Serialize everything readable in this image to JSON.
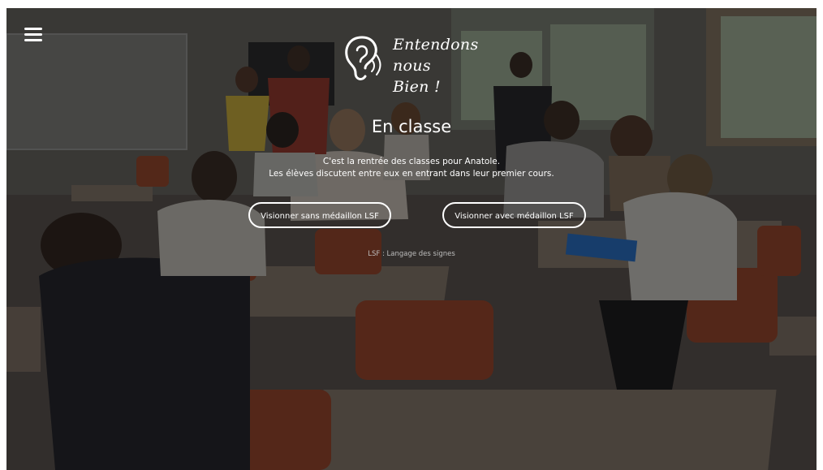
{
  "header": {
    "menu_icon": "hamburger-icon",
    "logo_icon": "ear-icon",
    "logo_line1": "Entendons nous",
    "logo_line2": "Bien !"
  },
  "scene": {
    "title": "En classe",
    "description_line1": "C'est la rentrée des classes pour Anatole.",
    "description_line2": "Les élèves discutent entre eux en entrant dans leur premier cours.",
    "buttons": [
      {
        "label": "Visionner sans médaillon LSF"
      },
      {
        "label": "Visionner avec médaillon LSF"
      }
    ],
    "note": "LSF : Langage des signes"
  },
  "colors": {
    "text": "#ffffff",
    "note": "#bdbdbd"
  }
}
